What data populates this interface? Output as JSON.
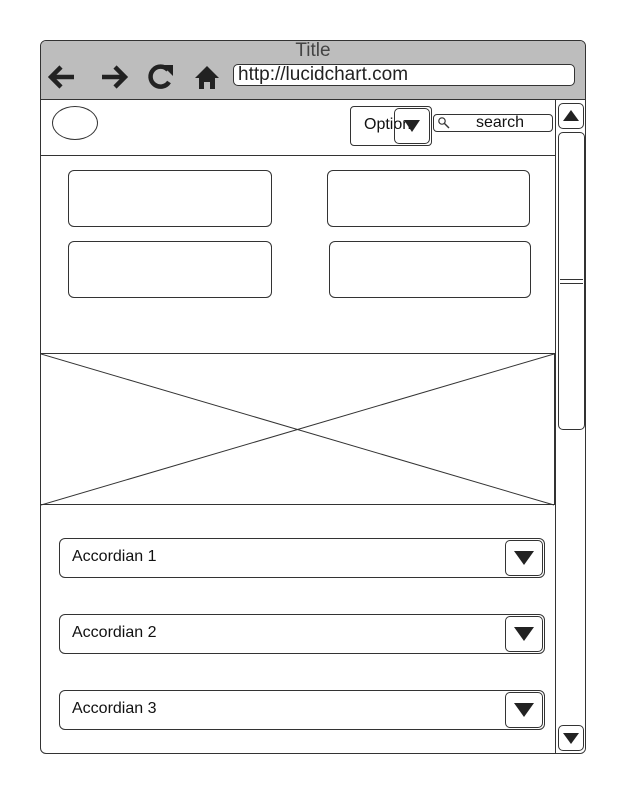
{
  "window": {
    "title": "Title",
    "url": "http://lucidchart.com"
  },
  "toolbar": {
    "icons": [
      "back-arrow-icon",
      "forward-arrow-icon",
      "refresh-icon",
      "home-icon"
    ]
  },
  "header": {
    "option_label": "Option",
    "search_placeholder": "search"
  },
  "accordions": [
    {
      "label": "Accordian 1"
    },
    {
      "label": "Accordian 2"
    },
    {
      "label": "Accordian 3"
    }
  ],
  "colors": {
    "titlebar": "#bdbdbd",
    "stroke": "#333333",
    "background": "#ffffff"
  }
}
